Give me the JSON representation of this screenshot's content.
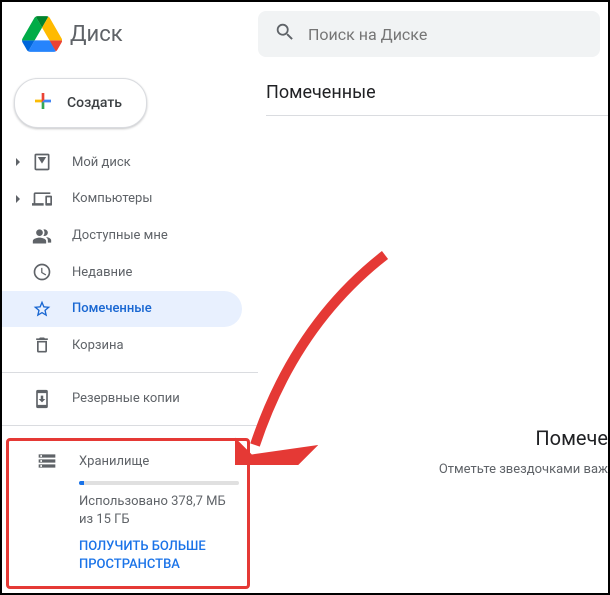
{
  "header": {
    "app_name": "Диск",
    "search_placeholder": "Поиск на Диске"
  },
  "sidebar": {
    "create_label": "Создать",
    "items": [
      {
        "label": "Мой диск",
        "icon": "my-drive",
        "expandable": true
      },
      {
        "label": "Компьютеры",
        "icon": "computers",
        "expandable": true
      },
      {
        "label": "Доступные мне",
        "icon": "shared",
        "expandable": false
      },
      {
        "label": "Недавние",
        "icon": "recent",
        "expandable": false
      },
      {
        "label": "Помеченные",
        "icon": "starred",
        "expandable": false,
        "selected": true
      },
      {
        "label": "Корзина",
        "icon": "trash",
        "expandable": false
      }
    ],
    "backups_label": "Резервные копии",
    "storage": {
      "title": "Хранилище",
      "usage_text": "Использовано 378,7 МБ из 15 ГБ",
      "used_mb": 378.7,
      "total_gb": 15,
      "upgrade_label": "ПОЛУЧИТЬ БОЛЬШЕ ПРОСТРАНСТВА"
    }
  },
  "main": {
    "title": "Помеченные",
    "empty_title": "Помече",
    "empty_subtitle": "Отметьте звездочками важ"
  }
}
